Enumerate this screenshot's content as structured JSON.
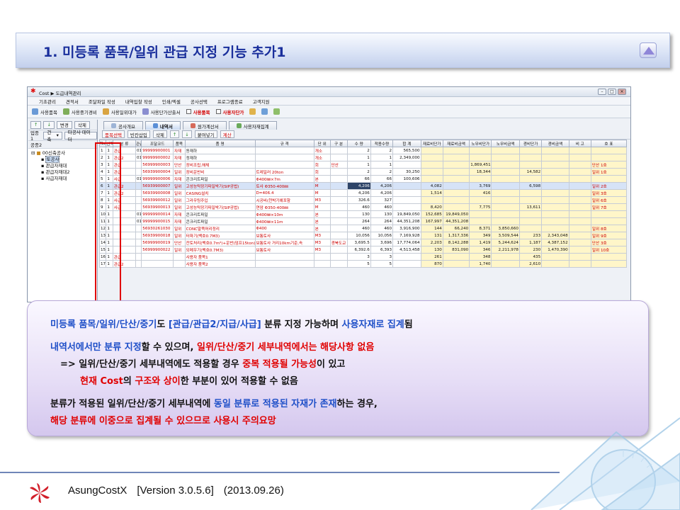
{
  "slide": {
    "title": "1. 미등록 품목/일위 관급 지정 기능 추가1"
  },
  "window": {
    "title": "Cost ▶ 도급내역관리",
    "menu": [
      "기초관리",
      "견적서",
      "조달파일 작성",
      "내역입찰 작성",
      "인쇄/엑셀",
      "공사선택",
      "프로그램종료",
      "고객지원"
    ],
    "toolbar": {
      "item1": "사용품목",
      "item2": "사용중기경비",
      "item3": "사용일위대가",
      "item4": "사용단가산출서",
      "check1": "사용품목",
      "check2": "사용자단가"
    },
    "left": {
      "btn_up": "↑",
      "btn_down": "↓",
      "btn_change": "변경",
      "btn_delete": "삭제",
      "select_label": "업종1",
      "select_value": "건축",
      "other_data": "타공사 데이터",
      "group": "공종2",
      "tree_root": "00신축공사",
      "tree_items": [
        "토공사",
        "관급자재대",
        "관급자재대2",
        "사급자재대"
      ]
    },
    "tabs": [
      "공사개요",
      "내역서",
      "원가계산서",
      "사용자재집계"
    ],
    "subbar": {
      "b1": "품목선택",
      "b2": "빈칸삽입",
      "b3": "삭제",
      "b4": "↑",
      "b5": "↓",
      "b6": "붙여넣기",
      "b7": "계산"
    },
    "columns": [
      "No",
      "선택",
      "분 류",
      "관급",
      "조달코드",
      "품목",
      "품 명",
      "규 격",
      "단 위",
      "구 분",
      "수 량",
      "적용수량",
      "합 계",
      "재료비단가",
      "재료비금액",
      "노무비단가",
      "노무비금액",
      "경비단가",
      "경비금액",
      "비 고",
      "호 표"
    ],
    "rows": [
      [
        "1",
        "1",
        "관급",
        "01",
        "99999900001",
        "자재",
        "동재하",
        "",
        "개소",
        "",
        "2",
        "2",
        "565,500",
        "",
        "",
        "",
        "",
        "",
        "",
        "",
        ""
      ],
      [
        "2",
        "1",
        "관급2",
        "01",
        "99999900002",
        "자재",
        "정재하",
        "",
        "개소",
        "",
        "1",
        "1",
        "2,349,000",
        "",
        "",
        "",
        "",
        "",
        "",
        "",
        ""
      ],
      [
        "3",
        "1",
        "관급",
        "",
        "56999900003",
        "단산",
        "장비조립,해체",
        "",
        "회",
        "단산",
        "1",
        "1",
        "",
        "",
        "",
        "1,869,451",
        "",
        "",
        "",
        "",
        "단산  1호"
      ],
      [
        "4",
        "1",
        "관급",
        "",
        "56939900004",
        "일위",
        "장비운반비",
        "트레일러 20ton",
        "회",
        "",
        "2",
        "2",
        "30,250",
        "",
        "",
        "18,344",
        "",
        "14,582",
        "",
        "",
        "일위  1호"
      ],
      [
        "5",
        "1",
        "사급",
        "01",
        "99999900006",
        "자재",
        "콘크리트파일",
        "Φ400㎜×7m",
        "본",
        "",
        "66",
        "66",
        "100,606",
        "",
        "",
        "",
        "",
        "",
        "",
        "",
        ""
      ],
      [
        "6",
        "1",
        "관급2",
        "",
        "56939900007",
        "일위",
        "고성능탁장기파일박기(SIP공법)",
        "토사 Φ350-400㎜",
        "M",
        "",
        "4,206",
        "4,206",
        "",
        "4,082",
        "",
        "3,769",
        "",
        "6,598",
        "",
        "",
        "일위  2호"
      ],
      [
        "7",
        "1",
        "관급2",
        "",
        "56939900008",
        "일위",
        "CASING설치",
        "D=406.4",
        "M",
        "",
        "4,206",
        "4,206",
        "",
        "1,514",
        "",
        "416",
        "",
        "",
        "",
        "",
        "일위  3호"
      ],
      [
        "8",
        "1",
        "사급",
        "",
        "56939900012",
        "일위",
        "그라우팅주입",
        "시공비(천박기예포함",
        "M3",
        "",
        "326.6",
        "327",
        "",
        "",
        "",
        "",
        "",
        "",
        "",
        "",
        "일위  6호"
      ],
      [
        "9",
        "1",
        "사급",
        "",
        "56939900013",
        "일위",
        "고성능탁장기파일박기(SIP공법)",
        "연암 Φ350-400㎜",
        "M",
        "",
        "460",
        "460",
        "",
        "8,420",
        "",
        "7,775",
        "",
        "13,611",
        "",
        "",
        "일위  7호"
      ],
      [
        "10",
        "1",
        "",
        "01",
        "99999900014",
        "자재",
        "콘크리트파일",
        "Φ400㎜×10m",
        "본",
        "",
        "130",
        "130",
        "19,849,050",
        "152,685",
        "19,849,050",
        "",
        "",
        "",
        "",
        "",
        ""
      ],
      [
        "11",
        "1",
        "",
        "01",
        "99999900015",
        "자재",
        "콘크리트파일",
        "Φ400㎜×11m",
        "본",
        "",
        "264",
        "264",
        "44,351,208",
        "167,997",
        "44,351,208",
        "",
        "",
        "",
        "",
        "",
        ""
      ],
      [
        "12",
        "1",
        "",
        "",
        "56930261030",
        "일위",
        "CONC말뚝머리정리",
        "Φ400",
        "본",
        "",
        "460",
        "460",
        "3,916,900",
        "144",
        "66,240",
        "8,371",
        "3,850,660",
        "",
        "",
        "",
        "일위  8호"
      ],
      [
        "13",
        "1",
        "",
        "",
        "56939900018",
        "일위",
        "터파기(백호0.7M3)",
        "보통토사",
        "M3",
        "",
        "10,056",
        "10,056",
        "7,169,928",
        "131",
        "1,317,336",
        "349",
        "3,509,544",
        "233",
        "2,343,048",
        "",
        "일위  9호"
      ],
      [
        "14",
        "1",
        "",
        "",
        "56999900019",
        "단산",
        "잔토처리(백호0.7m³)+운반(덤프15ton)",
        "보통토사 거리10km기준,속",
        "M3",
        "경북도교",
        "3,695.5",
        "3,696",
        "17,774,064",
        "2,203",
        "8,142,288",
        "1,419",
        "5,244,624",
        "1,187",
        "4,387,152",
        "",
        "단산  3호"
      ],
      [
        "15",
        "1",
        "",
        "",
        "56999900022",
        "일위",
        "되메우기(백호0.7M3)",
        "보통토사",
        "M3",
        "",
        "6,392.6",
        "6,393",
        "4,513,458",
        "130",
        "831,090",
        "346",
        "2,211,978",
        "230",
        "1,470,390",
        "",
        "일위 10호"
      ],
      [
        "16",
        "1",
        "관급",
        "",
        "",
        "",
        "사용자 품목1",
        "",
        "",
        "",
        "3",
        "3",
        "",
        "261",
        "",
        "348",
        "",
        "435",
        "",
        "",
        ""
      ],
      [
        "17",
        "1",
        "관급2",
        "",
        "",
        "",
        "사용자 품목2",
        "",
        "",
        "",
        "5",
        "5",
        "",
        "870",
        "",
        "1,740",
        "",
        "2,610",
        "",
        "",
        ""
      ]
    ]
  },
  "note": {
    "l1a": "미등록 품목/일위/단산/중기",
    "l1b": "도 ",
    "l1c": "[관급/관급2/지급/사급]",
    "l1d": " 분류 지정 가능하며 ",
    "l1e": "사용자재로 집계",
    "l1f": "됨",
    "l2a": "내역서에서만 분류 지정",
    "l2b": "할 수 있으며, ",
    "l2c": "일위/단산/중기 세부내역에서는 해당사항 없음",
    "l3a": "=> 일위/단산/중기 세부내역에도 적용할 경우 ",
    "l3b": "중복 적용될 가능성",
    "l3c": "이 있고",
    "l4a": "현재 Cost",
    "l4b": "의 ",
    "l4c": "구조와 상이",
    "l4d": "한 부분이 있어 적용할 수 없음",
    "l5a": "분류가 적용된 일위/단산/중기 세부내역에 ",
    "l5b": "동일 분류로 적용된 자재가 존재",
    "l5c": "하는 경우,",
    "l6": "해당 분류에 이중으로 집계될 수 있으므로 사용시 주의요망"
  },
  "footer": {
    "product": "AsungCostX",
    "version": "[Version 3.0.5.6]",
    "date": "(2013.09.26)"
  }
}
